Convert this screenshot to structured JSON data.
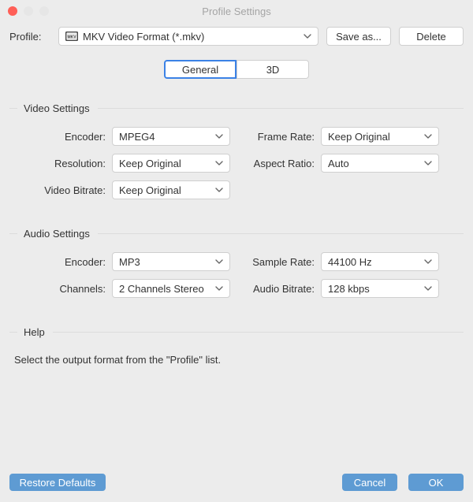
{
  "window": {
    "title": "Profile Settings"
  },
  "traffic": {
    "close": "#ff5f57",
    "min": "#e6e6e6",
    "zoom": "#e6e6e6"
  },
  "profile": {
    "label": "Profile:",
    "value": "MKV Video Format (*.mkv)",
    "saveAs": "Save as...",
    "delete": "Delete"
  },
  "tabs": {
    "general": "General",
    "threeD": "3D"
  },
  "video": {
    "title": "Video Settings",
    "encoderLabel": "Encoder:",
    "encoder": "MPEG4",
    "frameRateLabel": "Frame Rate:",
    "frameRate": "Keep Original",
    "resolutionLabel": "Resolution:",
    "resolution": "Keep Original",
    "aspectLabel": "Aspect Ratio:",
    "aspect": "Auto",
    "bitrateLabel": "Video Bitrate:",
    "bitrate": "Keep Original"
  },
  "audio": {
    "title": "Audio Settings",
    "encoderLabel": "Encoder:",
    "encoder": "MP3",
    "sampleLabel": "Sample Rate:",
    "sample": "44100 Hz",
    "channelsLabel": "Channels:",
    "channels": "2 Channels Stereo",
    "bitrateLabel": "Audio Bitrate:",
    "bitrate": "128 kbps"
  },
  "help": {
    "title": "Help",
    "text": "Select the output format from the \"Profile\" list."
  },
  "footer": {
    "restore": "Restore Defaults",
    "cancel": "Cancel",
    "ok": "OK"
  }
}
